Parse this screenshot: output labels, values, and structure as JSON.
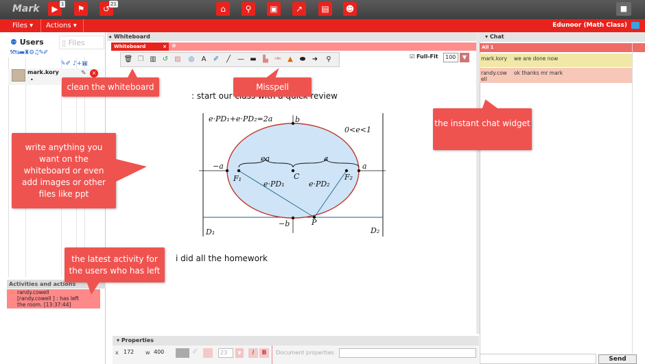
{
  "app": {
    "brand": "Mark"
  },
  "topbar": {
    "badges": {
      "video": "1",
      "history": "21"
    }
  },
  "menu": {
    "files": "Files",
    "actions": "Actions",
    "room": "Edunoor (Math Class)"
  },
  "left": {
    "tab_users": "Users",
    "tab_files": "Files",
    "user_name": "mark.kory",
    "user_status": "•",
    "activities_title": "Activities and actions",
    "activity_user": "randy.cowell",
    "activity_line2": "[randy.cowell ] : has left",
    "activity_line3": "the room. [13:37:44]"
  },
  "whiteboard": {
    "header": "Whiteboard",
    "tab": "Whiteboard",
    "fullfit_label": "Full-Fit",
    "zoom": "100",
    "text1": ": start our class with a quick review",
    "text2": "i did all the homework"
  },
  "properties": {
    "header": "Properties",
    "x_label": "x",
    "x_value": "172",
    "w_label": "w",
    "w_value": "400",
    "font_size": "23",
    "doc_props": "Document properties"
  },
  "chat": {
    "header": "Chat",
    "tab": "All 1",
    "messages": [
      {
        "user": "mark.kory",
        "text": "we are done now"
      },
      {
        "user": "randy.cow ell",
        "text": "ok thanks mr mark"
      }
    ],
    "send_label": "Send"
  },
  "callouts": {
    "clean": "clean the whiteboard",
    "misspell": "Misspell",
    "chat_widget": "the instant chat widget",
    "write": "write anything you want on the whiteboard or even add images or other files like ppt",
    "activity": "the latest activity for the users who has left"
  },
  "colors": {
    "accent": "#e8231d",
    "callout": "#ef5350",
    "topbar": "#4a4a4a"
  }
}
